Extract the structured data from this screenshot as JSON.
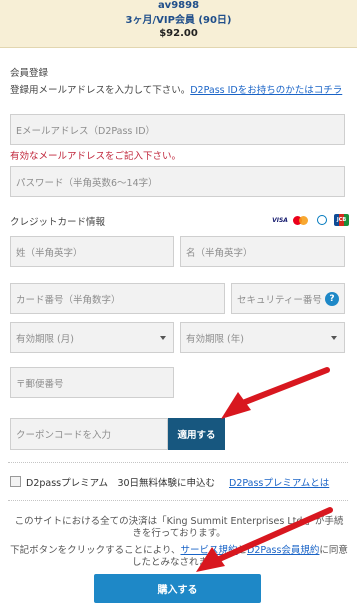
{
  "plan": {
    "id": "av9898",
    "name": "3ヶ月/VIP会員 (90日)",
    "price": "$92.00"
  },
  "registration": {
    "heading": "会員登録",
    "description": "登録用メールアドレスを入力して下さい。",
    "d2pass_link": "D2Pass IDをお持ちのかたはコチラ",
    "email_placeholder": "Eメールアドレス（D2Pass ID）",
    "email_error": "有効なメールアドレスをご記入下さい。",
    "password_placeholder": "パスワード（半角英数6～14字）"
  },
  "credit_card": {
    "heading": "クレジットカード情報",
    "brands": [
      "VISA",
      "MasterCard",
      "Diners",
      "JCB"
    ],
    "brand_icons": [
      "visa-icon",
      "mastercard-icon",
      "diners-icon",
      "jcb-icon"
    ],
    "surname_placeholder": "姓（半角英字）",
    "given_name_placeholder": "名（半角英字）",
    "card_number_placeholder": "カード番号（半角数字）",
    "security_code_placeholder": "セキュリティー番号",
    "security_help_icon": "?",
    "expiry_month_label": "有効期限 (月)",
    "expiry_year_label": "有効期限 (年)",
    "postal_placeholder": "〒郵便番号"
  },
  "coupon": {
    "placeholder": "クーポンコードを入力",
    "apply_label": "適用する"
  },
  "premium": {
    "label": "D2passプレミアム　30日無料体験に申込む",
    "link": "D2Passプレミアムとは"
  },
  "notices": {
    "line1": "このサイトにおける全ての決済は「King Summit Enterprises Ltd.」が手続きを行っております。",
    "line2_pre": "下記ボタンをクリックすることにより、",
    "line2_link1": "サービス規約",
    "line2_mid": "と",
    "line2_link2": "D2Pass会員規約",
    "line2_post": "に同意したとみなされます。"
  },
  "purchase": {
    "label": "購入する"
  },
  "colors": {
    "accent": "#1e88c7",
    "apply_button": "#17577f",
    "error": "#c0263b",
    "link": "#1a64c7",
    "annotation_arrow": "#d8171f",
    "plan_background": "#f7efd6"
  }
}
